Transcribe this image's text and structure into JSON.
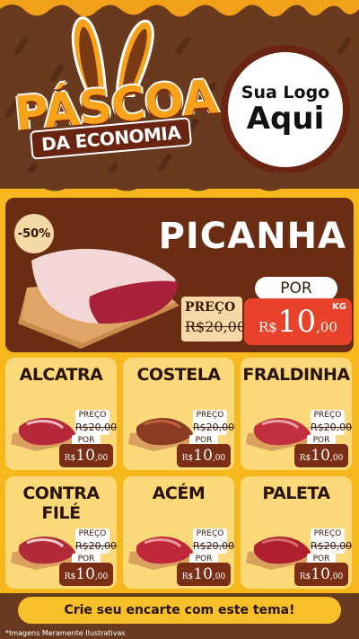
{
  "header": {
    "title_line1": "PÁSCOA",
    "title_line2": "DA ECONOMIA",
    "logo_line1": "Sua Logo",
    "logo_line2": "Aqui"
  },
  "hero": {
    "discount": "-50%",
    "name": "PICANHA",
    "preco_label": "PREÇO",
    "old_price": "R$20,00",
    "por_label": "POR",
    "price_prefix": "R$",
    "price_int": "10",
    "price_cents": ",00",
    "unit": "KG"
  },
  "products": [
    {
      "name": "ALCATRA",
      "preco_label": "PREÇO",
      "old_price": "R$20,00",
      "por_label": "POR",
      "price_prefix": "R$",
      "price_int": "10",
      "price_cents": ",00"
    },
    {
      "name": "COSTELA",
      "preco_label": "PREÇO",
      "old_price": "R$20,00",
      "por_label": "POR",
      "price_prefix": "R$",
      "price_int": "10",
      "price_cents": ",00"
    },
    {
      "name": "FRALDINHA",
      "preco_label": "PREÇO",
      "old_price": "R$20,00",
      "por_label": "POR",
      "price_prefix": "R$",
      "price_int": "10",
      "price_cents": ",00"
    },
    {
      "name": "CONTRA FILÉ",
      "preco_label": "PREÇO",
      "old_price": "R$20,00",
      "por_label": "POR",
      "price_prefix": "R$",
      "price_int": "10",
      "price_cents": ",00"
    },
    {
      "name": "ACÉM",
      "preco_label": "PREÇO",
      "old_price": "R$20,00",
      "por_label": "POR",
      "price_prefix": "R$",
      "price_int": "10",
      "price_cents": ",00"
    },
    {
      "name": "PALETA",
      "preco_label": "PREÇO",
      "old_price": "R$20,00",
      "por_label": "POR",
      "price_prefix": "R$",
      "price_int": "10",
      "price_cents": ",00"
    }
  ],
  "footer": {
    "cta": "Crie seu encarte com este tema!",
    "note": "*Imagens Meramente Ilustrativas"
  },
  "colors": {
    "background": "#f6b81c",
    "chocolate": "#6a3a1f",
    "price_red": "#e8422a",
    "price_brown": "#7a2e16",
    "card": "#fbd979"
  },
  "icons": {
    "bunny_ears": "bunny-ears-icon",
    "meat": "meat-icon"
  }
}
